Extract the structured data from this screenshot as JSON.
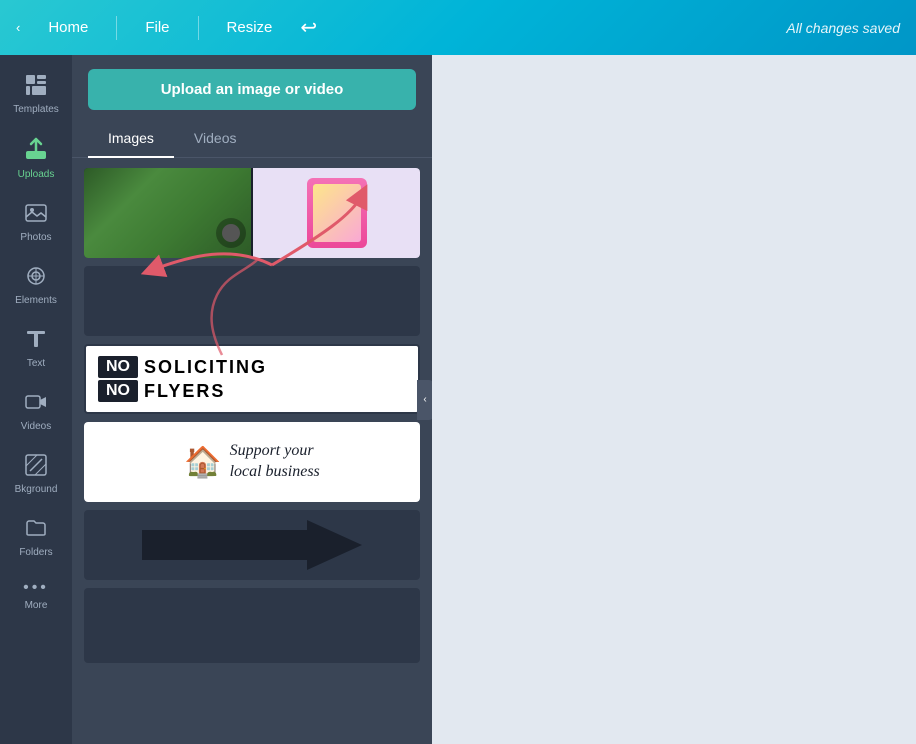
{
  "topbar": {
    "home_label": "Home",
    "file_label": "File",
    "resize_label": "Resize",
    "status": "All changes saved",
    "undo_symbol": "↩"
  },
  "sidebar": {
    "items": [
      {
        "id": "templates",
        "label": "Templates",
        "icon": "⊞",
        "active": false
      },
      {
        "id": "uploads",
        "label": "Uploads",
        "icon": "⬆",
        "active": true
      },
      {
        "id": "photos",
        "label": "Photos",
        "icon": "🖼",
        "active": false
      },
      {
        "id": "elements",
        "label": "Elements",
        "icon": "✦",
        "active": false
      },
      {
        "id": "text",
        "label": "Text",
        "icon": "T",
        "active": false
      },
      {
        "id": "videos",
        "label": "Videos",
        "icon": "▶",
        "active": false
      },
      {
        "id": "background",
        "label": "Bkground",
        "icon": "▣",
        "active": false
      },
      {
        "id": "folders",
        "label": "Folders",
        "icon": "📁",
        "active": false
      },
      {
        "id": "more",
        "label": "More",
        "icon": "···",
        "active": false
      }
    ]
  },
  "panel": {
    "upload_btn_label": "Upload an image or video",
    "tabs": [
      {
        "id": "images",
        "label": "Images",
        "active": true
      },
      {
        "id": "videos",
        "label": "Videos",
        "active": false
      }
    ],
    "collapse_icon": "‹"
  }
}
